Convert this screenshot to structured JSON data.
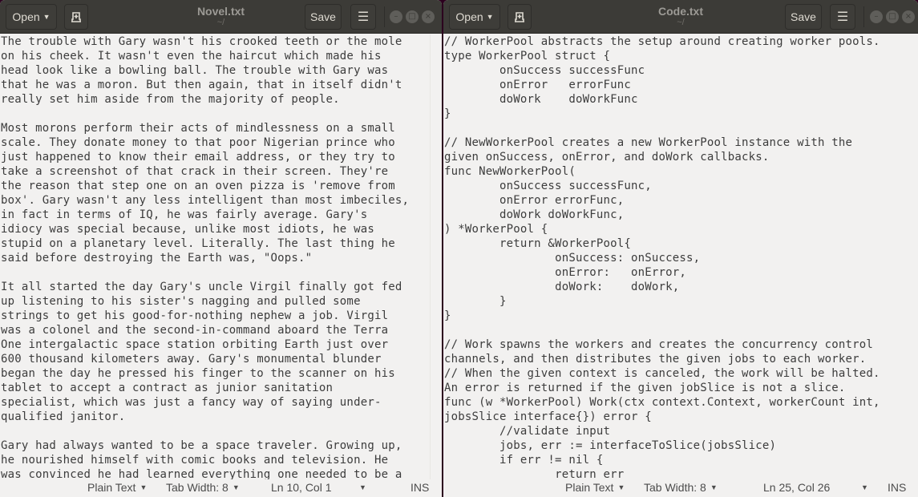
{
  "windows": [
    {
      "id": "novel",
      "header": {
        "open_label": "Open",
        "new_tab_icon": "new-tab-icon",
        "title": "Novel.txt",
        "subtitle": "~/",
        "save_label": "Save",
        "menu_icon": "hamburger-menu-icon",
        "controls": {
          "minimize": "–",
          "maximize": "□",
          "close": "×"
        }
      },
      "content": "The trouble with Gary wasn't his crooked teeth or the mole\non his cheek. It wasn't even the haircut which made his\nhead look like a bowling ball. The trouble with Gary was\nthat he was a moron. But then again, that in itself didn't\nreally set him aside from the majority of people.\n\nMost morons perform their acts of mindlessness on a small\nscale. They donate money to that poor Nigerian prince who\njust happened to know their email address, or they try to\ntake a screenshot of that crack in their screen. They're\nthe reason that step one on an oven pizza is 'remove from\nbox'. Gary wasn't any less intelligent than most imbeciles,\nin fact in terms of IQ, he was fairly average. Gary's\nidiocy was special because, unlike most idiots, he was\nstupid on a planetary level. Literally. The last thing he\nsaid before destroying the Earth was, \"Oops.\"\n\nIt all started the day Gary's uncle Virgil finally got fed\nup listening to his sister's nagging and pulled some\nstrings to get his good-for-nothing nephew a job. Virgil\nwas a colonel and the second-in-command aboard the Terra\nOne intergalactic space station orbiting Earth just over\n600 thousand kilometers away. Gary's monumental blunder\nbegan the day he pressed his finger to the scanner on his\ntablet to accept a contract as junior sanitation\nspecialist, which was just a fancy way of saying under-\nqualified janitor.\n\nGary had always wanted to be a space traveler. Growing up,\nhe nourished himself with comic books and television. He\nwas convinced he had learned everything one needed to be a",
      "status": {
        "language": "Plain Text",
        "tab_width": "Tab Width: 8",
        "position": "Ln 10, Col 1",
        "mode": "INS"
      }
    },
    {
      "id": "code",
      "header": {
        "open_label": "Open",
        "new_tab_icon": "new-tab-icon",
        "title": "Code.txt",
        "subtitle": "~/",
        "save_label": "Save",
        "menu_icon": "hamburger-menu-icon",
        "controls": {
          "minimize": "–",
          "maximize": "□",
          "close": "×"
        }
      },
      "content": "// WorkerPool abstracts the setup around creating worker pools.\ntype WorkerPool struct {\n\tonSuccess successFunc\n\tonError   errorFunc\n\tdoWork    doWorkFunc\n}\n\n// NewWorkerPool creates a new WorkerPool instance with the\ngiven onSuccess, onError, and doWork callbacks.\nfunc NewWorkerPool(\n\tonSuccess successFunc,\n\tonError errorFunc,\n\tdoWork doWorkFunc,\n) *WorkerPool {\n\treturn &WorkerPool{\n\t\tonSuccess: onSuccess,\n\t\tonError:   onError,\n\t\tdoWork:    doWork,\n\t}\n}\n\n// Work spawns the workers and creates the concurrency control\nchannels, and then distributes the given jobs to each worker.\n// When the given context is canceled, the work will be halted.\nAn error is returned if the given jobSlice is not a slice.\nfunc (w *WorkerPool) Work(ctx context.Context, workerCount int,\njobsSlice interface{}) error {\n\t//validate input\n\tjobs, err := interfaceToSlice(jobsSlice)\n\tif err != nil {\n\t\treturn err",
      "status": {
        "language": "Plain Text",
        "tab_width": "Tab Width: 8",
        "position": "Ln 25, Col 26",
        "mode": "INS"
      }
    }
  ],
  "colors": {
    "desktop_bg": "#2c001e",
    "headerbar_bg": "#3c3b37",
    "editor_bg": "#f2f1f0",
    "text": "#3c3c3c"
  }
}
